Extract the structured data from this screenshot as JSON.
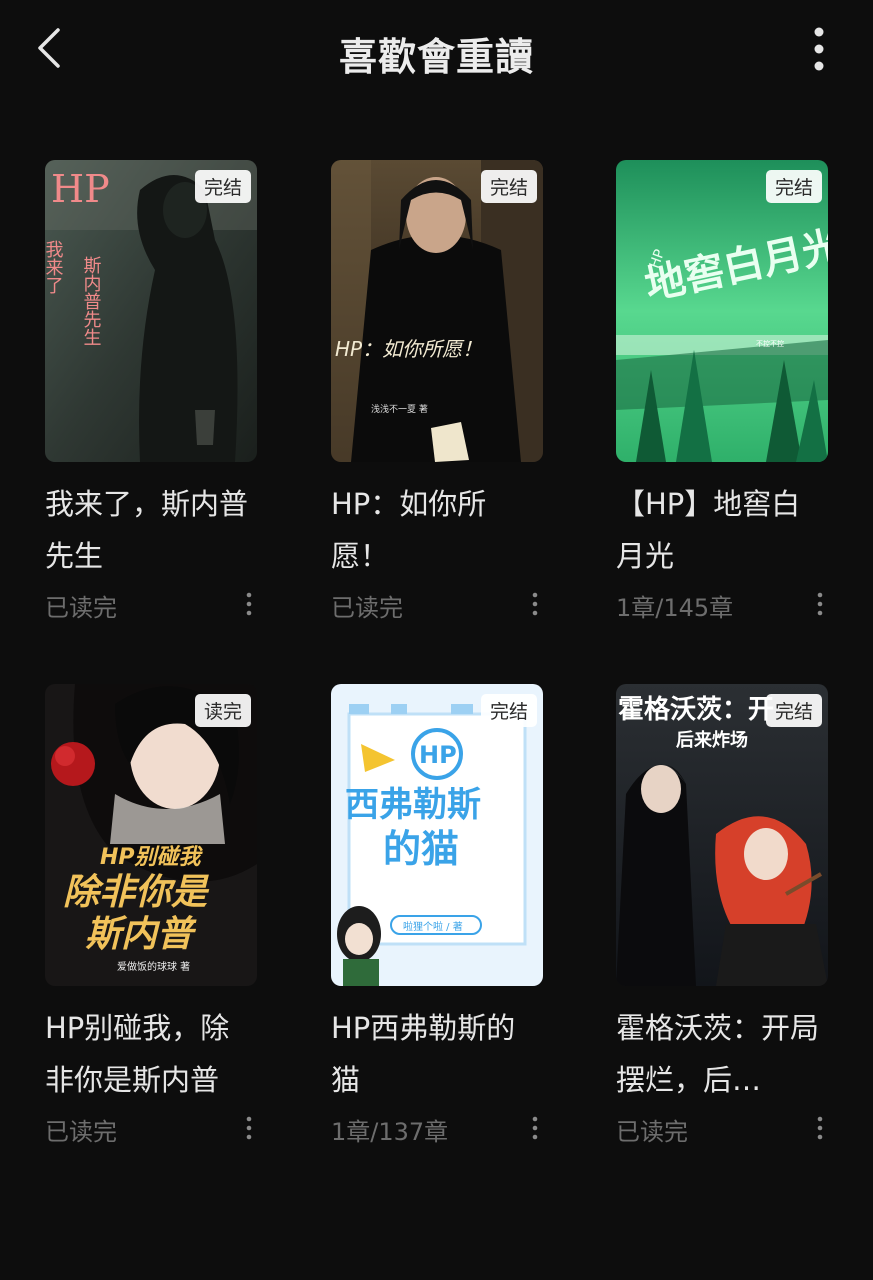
{
  "header": {
    "title": "喜歡會重讀",
    "back_icon": "chevron-left-icon",
    "more_icon": "more-vertical-icon"
  },
  "colors": {
    "background": "#0d0d0d",
    "title_text": "#e6e6e6",
    "meta_text": "#6d6d6d",
    "badge_bg": "#ffffff"
  },
  "books": [
    {
      "title": "我来了，斯内普先生",
      "badge": "完结",
      "progress": "已读完",
      "cover_text": {
        "top": "HP",
        "left": "我来了",
        "right": "斯内普先生"
      }
    },
    {
      "title": "HP：如你所愿！",
      "badge": "完结",
      "progress": "已读完",
      "cover_text": {
        "main": "HP：如你所愿！",
        "author": "浅浅不一夏 著"
      }
    },
    {
      "title": "【HP】地窖白月光",
      "badge": "完结",
      "progress": "1章/145章",
      "cover_text": {
        "main": "地窖白月光",
        "tag": "HP",
        "small": "不控不控"
      }
    },
    {
      "title": "HP别碰我，除非你是斯内普",
      "badge": "读完",
      "progress": "已读完",
      "cover_text": {
        "line1": "HP别碰我",
        "line2": "除非你是",
        "line3": "斯内普",
        "author": "爱做饭的球球 著"
      }
    },
    {
      "title": "HP西弗勒斯的猫",
      "badge": "完结",
      "progress": "1章/137章",
      "cover_text": {
        "tag": "HP",
        "line1": "西弗勒斯",
        "line2": "的猫",
        "author": "啦狸个啦 / 著"
      }
    },
    {
      "title": "霍格沃茨：开局摆烂，后…",
      "badge": "完结",
      "progress": "已读完",
      "cover_text": {
        "line1": "霍格沃茨：开",
        "line2": "后来炸场"
      }
    }
  ]
}
